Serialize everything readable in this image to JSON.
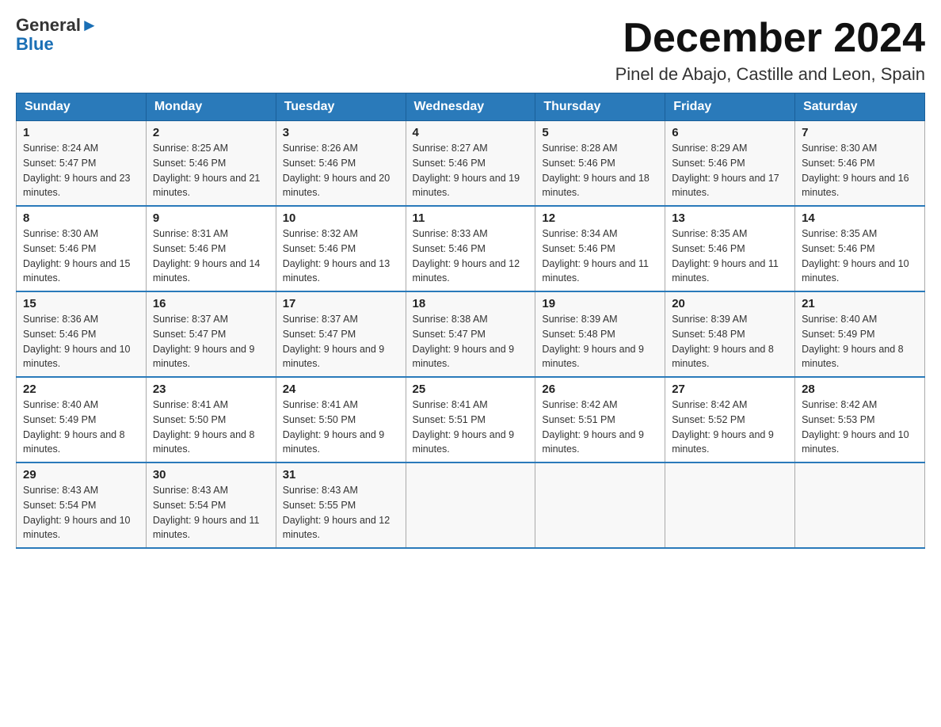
{
  "header": {
    "logo_general": "General",
    "logo_blue": "Blue",
    "month_title": "December 2024",
    "subtitle": "Pinel de Abajo, Castille and Leon, Spain"
  },
  "weekdays": [
    "Sunday",
    "Monday",
    "Tuesday",
    "Wednesday",
    "Thursday",
    "Friday",
    "Saturday"
  ],
  "weeks": [
    [
      {
        "day": "1",
        "sunrise": "8:24 AM",
        "sunset": "5:47 PM",
        "daylight": "9 hours and 23 minutes."
      },
      {
        "day": "2",
        "sunrise": "8:25 AM",
        "sunset": "5:46 PM",
        "daylight": "9 hours and 21 minutes."
      },
      {
        "day": "3",
        "sunrise": "8:26 AM",
        "sunset": "5:46 PM",
        "daylight": "9 hours and 20 minutes."
      },
      {
        "day": "4",
        "sunrise": "8:27 AM",
        "sunset": "5:46 PM",
        "daylight": "9 hours and 19 minutes."
      },
      {
        "day": "5",
        "sunrise": "8:28 AM",
        "sunset": "5:46 PM",
        "daylight": "9 hours and 18 minutes."
      },
      {
        "day": "6",
        "sunrise": "8:29 AM",
        "sunset": "5:46 PM",
        "daylight": "9 hours and 17 minutes."
      },
      {
        "day": "7",
        "sunrise": "8:30 AM",
        "sunset": "5:46 PM",
        "daylight": "9 hours and 16 minutes."
      }
    ],
    [
      {
        "day": "8",
        "sunrise": "8:30 AM",
        "sunset": "5:46 PM",
        "daylight": "9 hours and 15 minutes."
      },
      {
        "day": "9",
        "sunrise": "8:31 AM",
        "sunset": "5:46 PM",
        "daylight": "9 hours and 14 minutes."
      },
      {
        "day": "10",
        "sunrise": "8:32 AM",
        "sunset": "5:46 PM",
        "daylight": "9 hours and 13 minutes."
      },
      {
        "day": "11",
        "sunrise": "8:33 AM",
        "sunset": "5:46 PM",
        "daylight": "9 hours and 12 minutes."
      },
      {
        "day": "12",
        "sunrise": "8:34 AM",
        "sunset": "5:46 PM",
        "daylight": "9 hours and 11 minutes."
      },
      {
        "day": "13",
        "sunrise": "8:35 AM",
        "sunset": "5:46 PM",
        "daylight": "9 hours and 11 minutes."
      },
      {
        "day": "14",
        "sunrise": "8:35 AM",
        "sunset": "5:46 PM",
        "daylight": "9 hours and 10 minutes."
      }
    ],
    [
      {
        "day": "15",
        "sunrise": "8:36 AM",
        "sunset": "5:46 PM",
        "daylight": "9 hours and 10 minutes."
      },
      {
        "day": "16",
        "sunrise": "8:37 AM",
        "sunset": "5:47 PM",
        "daylight": "9 hours and 9 minutes."
      },
      {
        "day": "17",
        "sunrise": "8:37 AM",
        "sunset": "5:47 PM",
        "daylight": "9 hours and 9 minutes."
      },
      {
        "day": "18",
        "sunrise": "8:38 AM",
        "sunset": "5:47 PM",
        "daylight": "9 hours and 9 minutes."
      },
      {
        "day": "19",
        "sunrise": "8:39 AM",
        "sunset": "5:48 PM",
        "daylight": "9 hours and 9 minutes."
      },
      {
        "day": "20",
        "sunrise": "8:39 AM",
        "sunset": "5:48 PM",
        "daylight": "9 hours and 8 minutes."
      },
      {
        "day": "21",
        "sunrise": "8:40 AM",
        "sunset": "5:49 PM",
        "daylight": "9 hours and 8 minutes."
      }
    ],
    [
      {
        "day": "22",
        "sunrise": "8:40 AM",
        "sunset": "5:49 PM",
        "daylight": "9 hours and 8 minutes."
      },
      {
        "day": "23",
        "sunrise": "8:41 AM",
        "sunset": "5:50 PM",
        "daylight": "9 hours and 8 minutes."
      },
      {
        "day": "24",
        "sunrise": "8:41 AM",
        "sunset": "5:50 PM",
        "daylight": "9 hours and 9 minutes."
      },
      {
        "day": "25",
        "sunrise": "8:41 AM",
        "sunset": "5:51 PM",
        "daylight": "9 hours and 9 minutes."
      },
      {
        "day": "26",
        "sunrise": "8:42 AM",
        "sunset": "5:51 PM",
        "daylight": "9 hours and 9 minutes."
      },
      {
        "day": "27",
        "sunrise": "8:42 AM",
        "sunset": "5:52 PM",
        "daylight": "9 hours and 9 minutes."
      },
      {
        "day": "28",
        "sunrise": "8:42 AM",
        "sunset": "5:53 PM",
        "daylight": "9 hours and 10 minutes."
      }
    ],
    [
      {
        "day": "29",
        "sunrise": "8:43 AM",
        "sunset": "5:54 PM",
        "daylight": "9 hours and 10 minutes."
      },
      {
        "day": "30",
        "sunrise": "8:43 AM",
        "sunset": "5:54 PM",
        "daylight": "9 hours and 11 minutes."
      },
      {
        "day": "31",
        "sunrise": "8:43 AM",
        "sunset": "5:55 PM",
        "daylight": "9 hours and 12 minutes."
      },
      null,
      null,
      null,
      null
    ]
  ]
}
